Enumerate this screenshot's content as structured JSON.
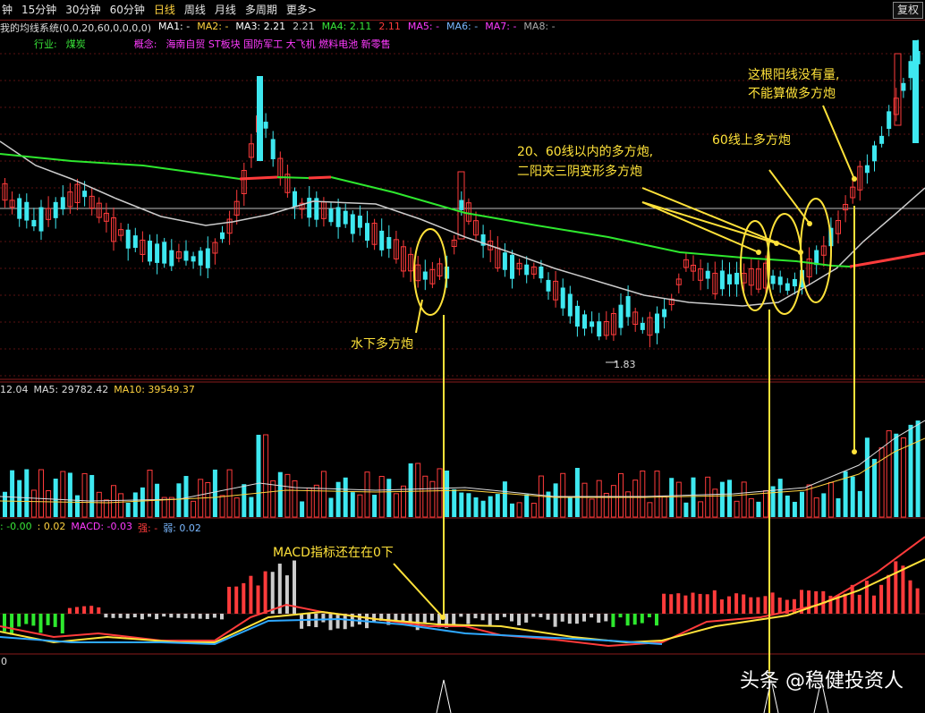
{
  "toolbar": {
    "tabs": [
      "钟",
      "15分钟",
      "30分钟",
      "60分钟",
      "日线",
      "周线",
      "月线",
      "多周期",
      "更多>"
    ],
    "active_tab": "日线",
    "fq_label": "复权"
  },
  "legend": {
    "system": "我的均线系统(0,0,20,60,0,0,0,0)",
    "ma": [
      {
        "text": "MA1: -",
        "color": "#ffffff"
      },
      {
        "text": "MA2: -",
        "color": "#ffd23f"
      },
      {
        "text": "MA3: 2.21",
        "color": "#ffffff"
      },
      {
        "text": "2.21",
        "color": "#cccccc"
      },
      {
        "text": "MA4: 2.11",
        "color": "#39e639"
      },
      {
        "text": "2.11",
        "color": "#ff3b3b"
      },
      {
        "text": "MA5: -",
        "color": "#ff3bff"
      },
      {
        "text": "MA6: -",
        "color": "#7ab8ff"
      },
      {
        "text": "MA7: -",
        "color": "#ff3bff"
      },
      {
        "text": "MA8: -",
        "color": "#aaaaaa"
      }
    ]
  },
  "industry": {
    "label": "行业:",
    "value": "煤炭"
  },
  "concept": {
    "label": "概念:",
    "value": "海南自贸 ST板块 国防军工 大飞机 燃料电池 新零售"
  },
  "low_label": "1.83",
  "volume": {
    "ma_prefix": "12.04",
    "ma5": "MA5: 29782.42",
    "ma10": "MA10: 39549.37"
  },
  "macd": {
    "dif": ": -0.00",
    "dea": ": 0.02",
    "macd": "MACD: -0.03",
    "qiang": "强: -",
    "ruo": "弱: 0.02",
    "zero": "0"
  },
  "annotations": {
    "a1": "水下多方炮",
    "a2_line1": "20、60线以内的多方炮,",
    "a2_line2": "二阳夹三阴变形多方炮",
    "a3": "60线上多方炮",
    "a4_line1": "这根阳线没有量,",
    "a4_line2": "不能算做多方炮",
    "a5": "MACD指标还在在0下"
  },
  "watermark": "头条 @稳健投资人",
  "colors": {
    "up": "#ff3b3b",
    "down": "#3ee8f0",
    "ma20": "#cccccc",
    "ma60": "#2ee82e",
    "anno": "#ffe23a"
  }
}
